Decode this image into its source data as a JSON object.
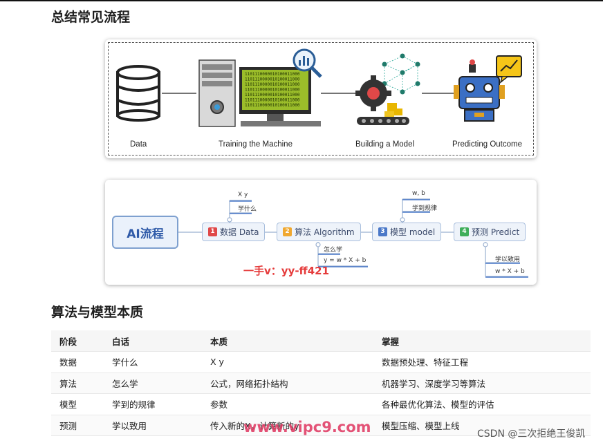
{
  "headings": {
    "process": "总结常见流程",
    "essence": "算法与模型本质"
  },
  "pipeline": {
    "captions": [
      "Data",
      "Training the Machine",
      "Building a Model",
      "Predicting Outcome"
    ],
    "binary_lines": [
      "1101110000010100011000",
      "1101110000010100011000",
      "1101110000010100011000",
      "1101110000010100011000",
      "1101110000010100011000",
      "1101110000010100011000",
      "1101110000010100011000"
    ]
  },
  "mindmap": {
    "root": "AI流程",
    "nodes": [
      {
        "num": "1",
        "label": "数据 Data",
        "color": "#e04848"
      },
      {
        "num": "2",
        "label": "算法 Algorithm",
        "color": "#f0a830"
      },
      {
        "num": "3",
        "label": "模型 model",
        "color": "#4a78c8"
      },
      {
        "num": "4",
        "label": "预测 Predict",
        "color": "#3fae5a"
      }
    ],
    "leaves": {
      "data_1": "X y",
      "data_2": "学什么",
      "algo_1": "怎么学",
      "algo_2": "y = w * X + b",
      "model_1": "w, b",
      "model_2": "学到规律",
      "predict_1": "学以致用",
      "predict_2": "w * X + b"
    }
  },
  "table": {
    "headers": [
      "阶段",
      "白话",
      "本质",
      "掌握"
    ],
    "rows": [
      [
        "数据",
        "学什么",
        "X y",
        "数据预处理、特征工程"
      ],
      [
        "算法",
        "怎么学",
        "公式，网络拓扑结构",
        "机器学习、深度学习等算法"
      ],
      [
        "模型",
        "学到的规律",
        "参数",
        "各种最优化算法、模型的评估"
      ],
      [
        "预测",
        "学以致用",
        "传入新的X，计算新的y",
        "模型压缩、模型上线"
      ]
    ]
  },
  "watermarks": {
    "w1": "一手v：yy-ff421",
    "w2": "www.vipc9.com",
    "w3": "CSDN @三次拒绝王俊凯"
  },
  "colors": {
    "accent": "#7ea0cf",
    "screen": "#9bbd2a"
  }
}
